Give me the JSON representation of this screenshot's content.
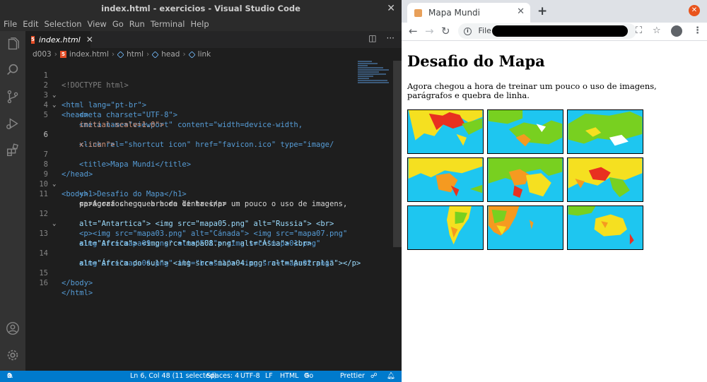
{
  "vscode": {
    "window_title": "index.html - exercicios - Visual Studio Code",
    "menu": [
      "File",
      "Edit",
      "Selection",
      "View",
      "Go",
      "Run",
      "Terminal",
      "Help"
    ],
    "tab": {
      "label": "index.html"
    },
    "breadcrumb": [
      "d003",
      "index.html",
      "html",
      "head",
      "link"
    ],
    "line_numbers": [
      "1",
      "2",
      "3",
      "4",
      "5",
      "6",
      "7",
      "8",
      "9",
      "10",
      "11",
      "12",
      "13",
      "14",
      "15",
      "16"
    ],
    "code": [
      "<!DOCTYPE html>",
      "<html lang=\"pt-br\">",
      "<head>",
      "<meta charset=\"UTF-8\">",
      "<meta name=\"viewport\" content=\"width=device-width,",
      "initial-scale=1.0\">",
      "<link rel=\"shortcut icon\" href=\"favicon.ico\" type=\"image/",
      "x-icon\">",
      "<title>Mapa Mundi</title>",
      "</head>",
      "<body>",
      "<h1>Desafio do Mapa</h1>",
      "<p>Agora chegou a hora de treinar um pouco o uso de imagens,",
      "parágrafos e quebra de linha.</p>",
      "<p><img src=\"mapa03.png\" alt=\"Cánada\"> <img src=\"mapa07.png\"",
      "alt=\"Antartica\"> <img src=\"mapa05.png\" alt=\"Russia\"> <br>",
      "<img src=\"mapa09.png\" alt=\"EUA\"> <img src=\"mapa01.png\"",
      "alt=\"Africa\"> <img src=\"mapa08.png\" alt=\"Ásia\"> <br>",
      "<img src=\"mapa06.png\" alt=\"brasil\"> <img src=\"mapa02.png\"",
      "alt=\"África do sul\"> <img src=\"mapa04.png\" alt=\"Australia\"></p>",
      "</body>",
      "</html>"
    ],
    "status": {
      "errors": "0",
      "warnings": "0",
      "cursor": "Ln 6, Col 48 (11 selected)",
      "spaces": "Spaces: 4",
      "encoding": "UTF-8",
      "eol": "LF",
      "language": "HTML",
      "golive": "Go Live",
      "prettier": "Prettier"
    }
  },
  "browser": {
    "tab_title": "Mapa Mundi",
    "address_prefix": "File",
    "page": {
      "heading": "Desafio do Mapa",
      "paragraph": "Agora chegou a hora de treinar um pouco o uso de imagens, parágrafos e quebra de linha."
    }
  },
  "colors": {
    "map_ocean": "#1ec6f0",
    "map_land_green": "#78d020",
    "map_land_yellow": "#f5e020",
    "map_land_orange": "#f59a20",
    "map_land_red": "#e83020",
    "map_land_white": "#ffffff"
  }
}
